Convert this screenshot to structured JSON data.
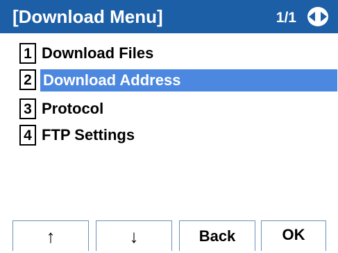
{
  "titlebar": {
    "title": "[Download Menu]",
    "page": "1/1",
    "nav_icon": "four-way-nav-icon"
  },
  "menu": {
    "items": [
      {
        "num": "1",
        "label": "Download Files",
        "selected": false
      },
      {
        "num": "2",
        "label": "Download Address",
        "selected": true
      },
      {
        "num": "3",
        "label": "Protocol",
        "selected": false
      },
      {
        "num": "4",
        "label": "FTP Settings",
        "selected": false
      }
    ]
  },
  "softkeys": {
    "up": "↑",
    "down": "↓",
    "back": "Back",
    "ok": "OK"
  },
  "colors": {
    "title_bg": "#1d5fa6",
    "highlight": "#4c88e0",
    "softkey_border": "#6a8fb8"
  }
}
